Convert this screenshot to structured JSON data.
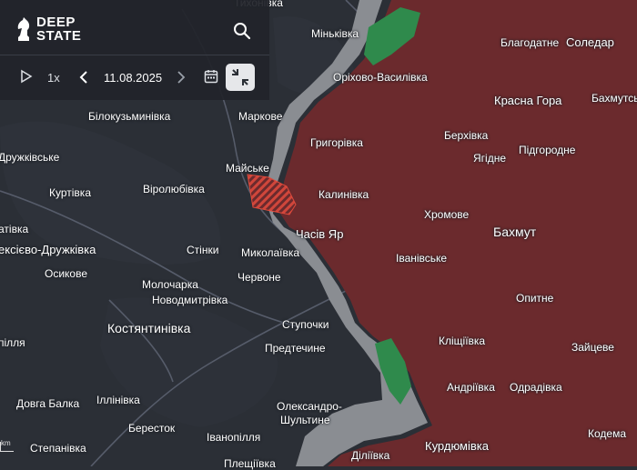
{
  "app": {
    "logo_line1": "DEEP",
    "logo_line2": "STATE"
  },
  "controls": {
    "speed": "1x",
    "date": "11.08.2025"
  },
  "scale_label": "km",
  "colors": {
    "background": "#2b2f36",
    "occupied": "#6b2a2d",
    "contested": "#8a8d92",
    "liberated_green": "#2f8a4c",
    "hatched": "#c0392b",
    "panel": "#21242a"
  },
  "places": [
    {
      "name": "Тихонівка",
      "cls": ""
    },
    {
      "name": "Міньківка",
      "cls": ""
    },
    {
      "name": "Благодатне",
      "cls": ""
    },
    {
      "name": "Соледар",
      "cls": "big"
    },
    {
      "name": "Оріхово-Василівка",
      "cls": ""
    },
    {
      "name": "Красна Гора",
      "cls": "big"
    },
    {
      "name": "Бахмутсь",
      "cls": ""
    },
    {
      "name": "Білокузьминівка",
      "cls": ""
    },
    {
      "name": "Маркове",
      "cls": ""
    },
    {
      "name": "Григорівка",
      "cls": ""
    },
    {
      "name": "Берхівка",
      "cls": ""
    },
    {
      "name": "Підгородне",
      "cls": ""
    },
    {
      "name": "Ягідне",
      "cls": ""
    },
    {
      "name": "Дружківське",
      "cls": ""
    },
    {
      "name": "Майське",
      "cls": ""
    },
    {
      "name": "Куртівка",
      "cls": ""
    },
    {
      "name": "Віролюбівка",
      "cls": ""
    },
    {
      "name": "Калинівка",
      "cls": ""
    },
    {
      "name": "Хромове",
      "cls": ""
    },
    {
      "name": "атівка",
      "cls": ""
    },
    {
      "name": "Бахмут",
      "cls": "big2"
    },
    {
      "name": "Часів Яр",
      "cls": "big"
    },
    {
      "name": "ексієво-Дружківка",
      "cls": "big"
    },
    {
      "name": "Стінки",
      "cls": ""
    },
    {
      "name": "Миколаївка",
      "cls": ""
    },
    {
      "name": "Іванівське",
      "cls": ""
    },
    {
      "name": "Осикове",
      "cls": ""
    },
    {
      "name": "Червоне",
      "cls": ""
    },
    {
      "name": "Молочарка",
      "cls": ""
    },
    {
      "name": "Новодмитрівка",
      "cls": ""
    },
    {
      "name": "Опитне",
      "cls": ""
    },
    {
      "name": "Ступочки",
      "cls": ""
    },
    {
      "name": "Костянтинівка",
      "cls": "city"
    },
    {
      "name": "Кліщіївка",
      "cls": ""
    },
    {
      "name": "Зайцеве",
      "cls": ""
    },
    {
      "name": "Предтечине",
      "cls": ""
    },
    {
      "name": "пілля",
      "cls": ""
    },
    {
      "name": "Андріївка",
      "cls": ""
    },
    {
      "name": "Одрадівка",
      "cls": ""
    },
    {
      "name": "Олександро-",
      "cls": ""
    },
    {
      "name": "Шультине",
      "cls": ""
    },
    {
      "name": "Довга Балка",
      "cls": ""
    },
    {
      "name": "Іллінівка",
      "cls": ""
    },
    {
      "name": "Бересток",
      "cls": ""
    },
    {
      "name": "Кодема",
      "cls": ""
    },
    {
      "name": "Іванопілля",
      "cls": ""
    },
    {
      "name": "Курдюмівка",
      "cls": "big"
    },
    {
      "name": "Степанівка",
      "cls": ""
    },
    {
      "name": "Діліївка",
      "cls": ""
    },
    {
      "name": "Плещіївка",
      "cls": ""
    }
  ]
}
